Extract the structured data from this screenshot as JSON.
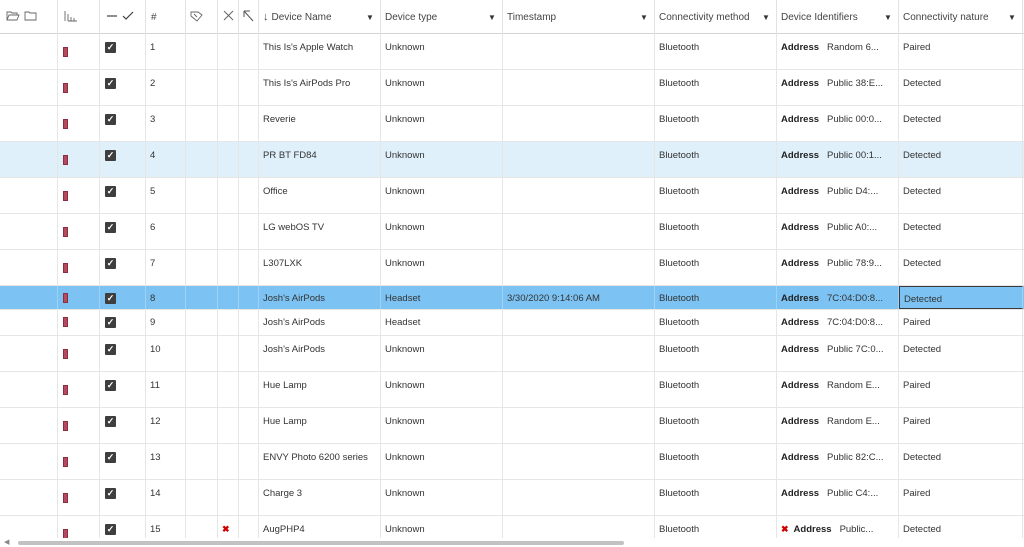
{
  "header": {
    "icons": {
      "folder_open": "folder-open-icon",
      "folder": "folder-icon",
      "columns": "columns-chart-icon",
      "collapse": "collapse-dash-icon",
      "check": "check-icon",
      "tag": "tag-icon",
      "close": "close-x-icon",
      "cursor": "cursor-arrow-icon"
    },
    "col_num": "#",
    "col_device_name": "Device Name",
    "sort_indicator": "↓",
    "col_device_type": "Device type",
    "col_timestamp": "Timestamp",
    "col_conn_method": "Connectivity method",
    "col_identifiers": "Device Identifiers",
    "col_conn_nature": "Connectivity nature"
  },
  "rows": [
    {
      "num": "1",
      "name": "This Is's Apple Watch",
      "type": "Unknown",
      "timestamp": "",
      "method": "Bluetooth",
      "addr_label": "Address",
      "addr": "Random 6...",
      "nature": "Paired",
      "error": false
    },
    {
      "num": "2",
      "name": "This Is's AirPods Pro",
      "type": "Unknown",
      "timestamp": "",
      "method": "Bluetooth",
      "addr_label": "Address",
      "addr": "Public 38:E...",
      "nature": "Detected",
      "error": false
    },
    {
      "num": "3",
      "name": "Reverie",
      "type": "Unknown",
      "timestamp": "",
      "method": "Bluetooth",
      "addr_label": "Address",
      "addr": "Public 00:0...",
      "nature": "Detected",
      "error": false
    },
    {
      "num": "4",
      "name": "PR BT FD84",
      "type": "Unknown",
      "timestamp": "",
      "method": "Bluetooth",
      "addr_label": "Address",
      "addr": "Public 00:1...",
      "nature": "Detected",
      "error": false
    },
    {
      "num": "5",
      "name": "Office",
      "type": "Unknown",
      "timestamp": "",
      "method": "Bluetooth",
      "addr_label": "Address",
      "addr": "Public D4:...",
      "nature": "Detected",
      "error": false
    },
    {
      "num": "6",
      "name": "LG webOS TV",
      "type": "Unknown",
      "timestamp": "",
      "method": "Bluetooth",
      "addr_label": "Address",
      "addr": "Public A0:...",
      "nature": "Detected",
      "error": false
    },
    {
      "num": "7",
      "name": "L307LXK",
      "type": "Unknown",
      "timestamp": "",
      "method": "Bluetooth",
      "addr_label": "Address",
      "addr": "Public 78:9...",
      "nature": "Detected",
      "error": false
    },
    {
      "num": "8",
      "name": "Josh's AirPods",
      "type": "Headset",
      "timestamp": "3/30/2020 9:14:06 AM",
      "method": "Bluetooth",
      "addr_label": "Address",
      "addr": "7C:04:D0:8...",
      "nature": "Detected",
      "error": false
    },
    {
      "num": "9",
      "name": "Josh's AirPods",
      "type": "Headset",
      "timestamp": "",
      "method": "Bluetooth",
      "addr_label": "Address",
      "addr": "7C:04:D0:8...",
      "nature": "Paired",
      "error": false
    },
    {
      "num": "10",
      "name": "Josh's AirPods",
      "type": "Unknown",
      "timestamp": "",
      "method": "Bluetooth",
      "addr_label": "Address",
      "addr": "Public 7C:0...",
      "nature": "Detected",
      "error": false
    },
    {
      "num": "11",
      "name": "Hue Lamp",
      "type": "Unknown",
      "timestamp": "",
      "method": "Bluetooth",
      "addr_label": "Address",
      "addr": "Random E...",
      "nature": "Paired",
      "error": false
    },
    {
      "num": "12",
      "name": "Hue Lamp",
      "type": "Unknown",
      "timestamp": "",
      "method": "Bluetooth",
      "addr_label": "Address",
      "addr": "Random E...",
      "nature": "Paired",
      "error": false
    },
    {
      "num": "13",
      "name": "ENVY Photo 6200 series",
      "type": "Unknown",
      "timestamp": "",
      "method": "Bluetooth",
      "addr_label": "Address",
      "addr": "Public 82:C...",
      "nature": "Detected",
      "error": false
    },
    {
      "num": "14",
      "name": "Charge 3",
      "type": "Unknown",
      "timestamp": "",
      "method": "Bluetooth",
      "addr_label": "Address",
      "addr": "Public C4:...",
      "nature": "Paired",
      "error": false
    },
    {
      "num": "15",
      "name": "AugPHP4",
      "type": "Unknown",
      "timestamp": "",
      "method": "Bluetooth",
      "addr_label": "Address",
      "addr": "Public...",
      "nature": "Detected",
      "error": true
    }
  ],
  "colors": {
    "flag": "#b34a5e",
    "selected_row": "#7cc3f3",
    "hover_row": "#dff0fb",
    "error_mark": "#d00000"
  }
}
